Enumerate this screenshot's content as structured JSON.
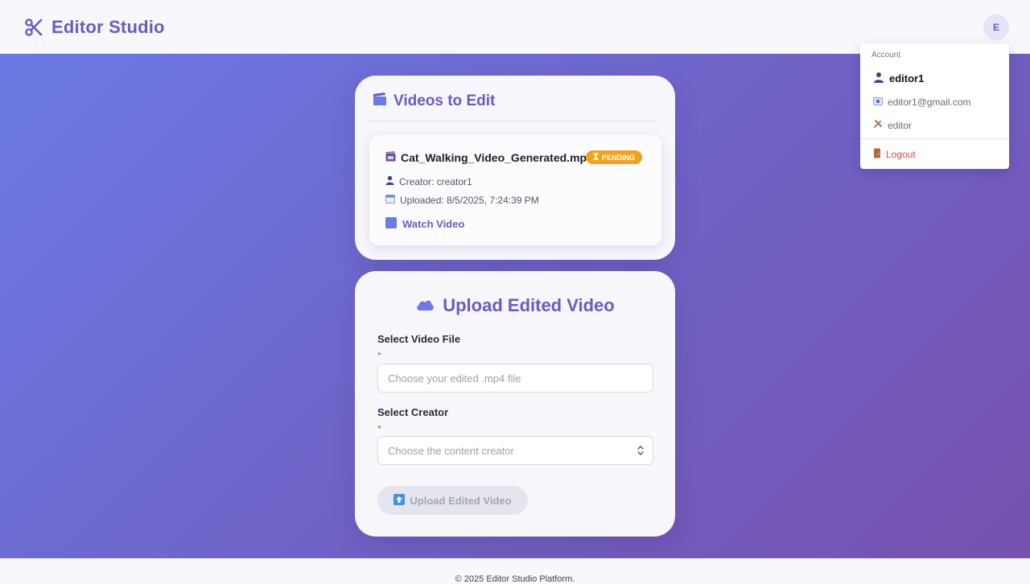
{
  "header": {
    "brand_title": "Editor Studio",
    "avatar_initial": "E"
  },
  "account_menu": {
    "header": "Account",
    "username": "editor1",
    "email": "editor1@gmail.com",
    "role": "editor",
    "logout_label": "Logout"
  },
  "videos_card": {
    "title": "Videos to Edit",
    "items": [
      {
        "filename": "Cat_Walking_Video_Generated.mp4",
        "status": "PENDING",
        "creator": "Creator: creator1",
        "uploaded": "Uploaded: 8/5/2025, 7:24:39 PM",
        "watch_label": "Watch Video"
      }
    ]
  },
  "upload_card": {
    "title": "Upload Edited Video",
    "file_label": "Select Video File",
    "required_mark": "*",
    "file_placeholder": "Choose your edited .mp4 file",
    "creator_label": "Select Creator",
    "creator_placeholder": "Choose the content creator",
    "submit_label": "Upload Edited Video"
  },
  "footer": {
    "text": "© 2025 Editor Studio Platform."
  },
  "colors": {
    "accent": "#6a5bc3",
    "badge_pending": "#f4a21b",
    "logout": "#d84a4a"
  }
}
